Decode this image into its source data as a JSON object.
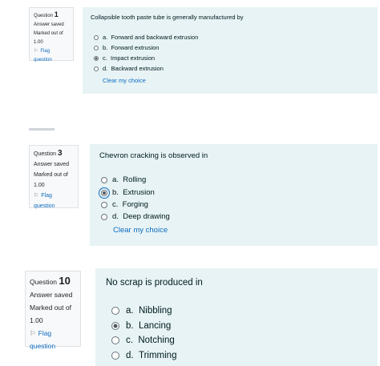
{
  "questions": [
    {
      "label": "Question",
      "number": "1",
      "state": "Answer saved",
      "marked_out_of": "Marked out of",
      "marks": "1.00",
      "flag_label": "Flag question",
      "text": "Collapsible tooth paste tube is generally manufactured by",
      "options": [
        {
          "letter": "a.",
          "text": "Forward and backward extrusion",
          "selected": false
        },
        {
          "letter": "b.",
          "text": "Forward extrusion",
          "selected": false
        },
        {
          "letter": "c.",
          "text": "Impact extrusion",
          "selected": true
        },
        {
          "letter": "d.",
          "text": "Backward extrusion",
          "selected": false
        }
      ],
      "clear_label": "Clear my choice"
    },
    {
      "label": "Question",
      "number": "3",
      "state": "Answer saved",
      "marked_out_of": "Marked out of",
      "marks": "1.00",
      "flag_label": "Flag question",
      "text": "Chevron cracking is observed in",
      "options": [
        {
          "letter": "a.",
          "text": "Rolling",
          "selected": false
        },
        {
          "letter": "b.",
          "text": "Extrusion",
          "selected": true
        },
        {
          "letter": "c.",
          "text": "Forging",
          "selected": false
        },
        {
          "letter": "d.",
          "text": "Deep drawing",
          "selected": false
        }
      ],
      "clear_label": "Clear my choice"
    },
    {
      "label": "Question",
      "number": "10",
      "state": "Answer saved",
      "marked_out_of": "Marked out of",
      "marks": "1.00",
      "flag_label": "Flag question",
      "text": "No scrap is produced in",
      "options": [
        {
          "letter": "a.",
          "text": "Nibbling",
          "selected": false
        },
        {
          "letter": "b.",
          "text": "Lancing",
          "selected": true
        },
        {
          "letter": "c.",
          "text": "Notching",
          "selected": false
        },
        {
          "letter": "d.",
          "text": "Trimming",
          "selected": false
        }
      ]
    }
  ],
  "icons": {
    "flag": "flag-icon",
    "radio": "radio-button"
  },
  "colors": {
    "panel_bg": "#e7f3f5",
    "info_bg": "#f8f9fa",
    "link": "#0f6cbf"
  }
}
